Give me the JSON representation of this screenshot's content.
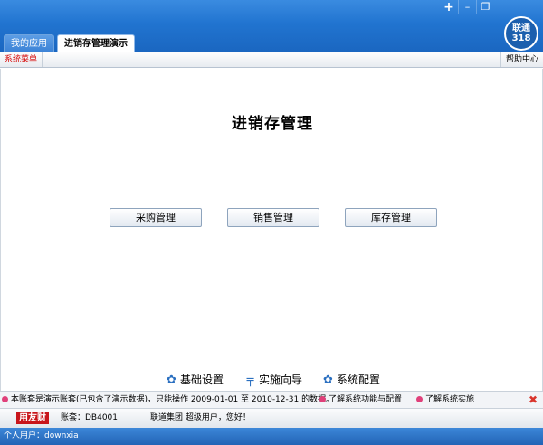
{
  "window": {
    "controls": {
      "plus": "+",
      "minimize": "–",
      "restore": "❐",
      "close": "✕"
    },
    "logo": {
      "line1": "联通",
      "line2": "318"
    }
  },
  "tabs": [
    {
      "label": "我的应用",
      "active": false
    },
    {
      "label": "进销存管理演示",
      "active": true
    }
  ],
  "menubar": {
    "left": "系统菜单",
    "right": "帮助中心"
  },
  "main": {
    "title": "进销存管理",
    "buttons": [
      "采购管理",
      "销售管理",
      "库存管理"
    ],
    "quick_links": [
      {
        "label": "基础设置",
        "icon": "gear-icon"
      },
      {
        "label": "实施向导",
        "icon": "signpost-icon"
      },
      {
        "label": "系统配置",
        "icon": "gear-icon"
      }
    ]
  },
  "notice": {
    "text": "本账套是演示账套(已包含了演示数据)，只能操作 2009-01-01 至 2010-12-31 的数据。",
    "link1": "了解系统功能与配置",
    "link2": "了解系统实施",
    "close": "✖"
  },
  "info": {
    "brand": "用友财",
    "account": "账套：DB4001",
    "company": "联道集团 超级用户，您好！"
  },
  "status": {
    "text": "个人用户：downxia"
  },
  "colors": {
    "title_blue": "#2174d0",
    "menu_red": "#d40000",
    "close_red": "#d9342b",
    "dot_pink": "#e0407a"
  }
}
